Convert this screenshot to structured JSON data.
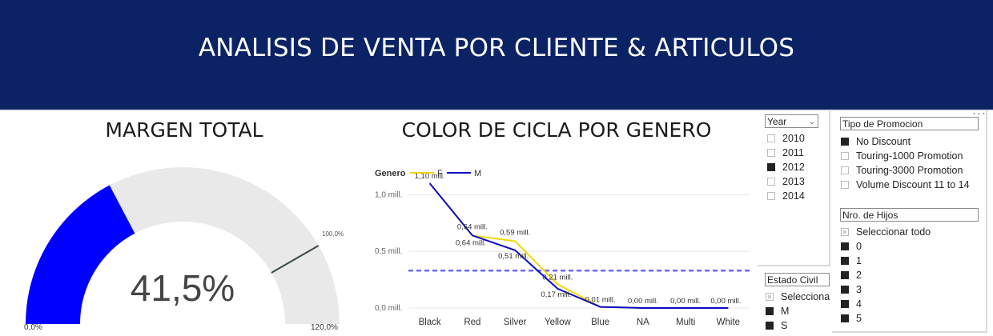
{
  "header": {
    "title": "ANALISIS DE VENTA POR CLIENTE & ARTICULOS",
    "background": "#0b2365"
  },
  "gauge": {
    "title": "MARGEN TOTAL",
    "value_label": "41,5%",
    "value": 41.5,
    "min": 0,
    "max": 120,
    "target": 100,
    "min_label": "0,0%",
    "max_label": "120,0%",
    "target_label": "100,0%",
    "fill_color": "#0000ff",
    "track_color": "#e9e9e9"
  },
  "chart_data": {
    "type": "line",
    "title": "COLOR DE CICLA POR GENERO",
    "legend_title": "Genero",
    "legend_position": "top-left",
    "categories": [
      "Black",
      "Red",
      "Silver",
      "Yellow",
      "Blue",
      "NA",
      "Multi",
      "White"
    ],
    "series": [
      {
        "name": "F",
        "color": "#f2d600",
        "values": [
          1.1,
          0.64,
          0.59,
          0.21,
          0.01,
          0.0,
          0.0,
          0.0
        ]
      },
      {
        "name": "M",
        "color": "#0b0bc8",
        "values": [
          1.1,
          0.64,
          0.51,
          0.17,
          0.01,
          0.0,
          0.0,
          0.0
        ]
      }
    ],
    "data_labels": {
      "F": [
        "1,10 mill.",
        "0,64 mill.",
        "0,59 mill.",
        "0,21 mill.",
        "0,01 mill.",
        "0,00 mill.",
        "0,00 mill.",
        "0,00 mill."
      ],
      "M": [
        "",
        "0,64 mill.",
        "0,51 mill.",
        "0,17 mill.",
        "",
        "",
        "",
        ""
      ]
    },
    "y_ticks": [
      {
        "value": 0,
        "label": "0,0 mill."
      },
      {
        "value": 0.5,
        "label": "0,5 mill."
      },
      {
        "value": 1.0,
        "label": "1,0 mill."
      }
    ],
    "ylim": [
      0,
      1.2
    ],
    "average_line": 0.33,
    "average_color": "#6b6bff",
    "grid": true
  },
  "slicers": {
    "year": {
      "label": "Year",
      "items": [
        {
          "label": "2010",
          "state": "off"
        },
        {
          "label": "2011",
          "state": "off"
        },
        {
          "label": "2012",
          "state": "on"
        },
        {
          "label": "2013",
          "state": "off"
        },
        {
          "label": "2014",
          "state": "off"
        }
      ]
    },
    "promocion": {
      "label": "Tipo de Promocion",
      "more_icon": "ellipsis-icon",
      "items": [
        {
          "label": "No Discount",
          "state": "on"
        },
        {
          "label": "Touring-1000 Promotion",
          "state": "off"
        },
        {
          "label": "Touring-3000 Promotion",
          "state": "off"
        },
        {
          "label": "Volume Discount 11 to 14",
          "state": "off"
        }
      ]
    },
    "hijos": {
      "label": "Nro. de Hijos",
      "items": [
        {
          "label": "Seleccionar todo",
          "state": "partial"
        },
        {
          "label": "0",
          "state": "on"
        },
        {
          "label": "1",
          "state": "on"
        },
        {
          "label": "2",
          "state": "on"
        },
        {
          "label": "3",
          "state": "on"
        },
        {
          "label": "4",
          "state": "on"
        },
        {
          "label": "5",
          "state": "on"
        }
      ]
    },
    "estado_civil": {
      "label": "Estado Civil",
      "items": [
        {
          "label": "Seleccionar todo",
          "state": "partial"
        },
        {
          "label": "M",
          "state": "on"
        },
        {
          "label": "S",
          "state": "on"
        }
      ]
    }
  }
}
